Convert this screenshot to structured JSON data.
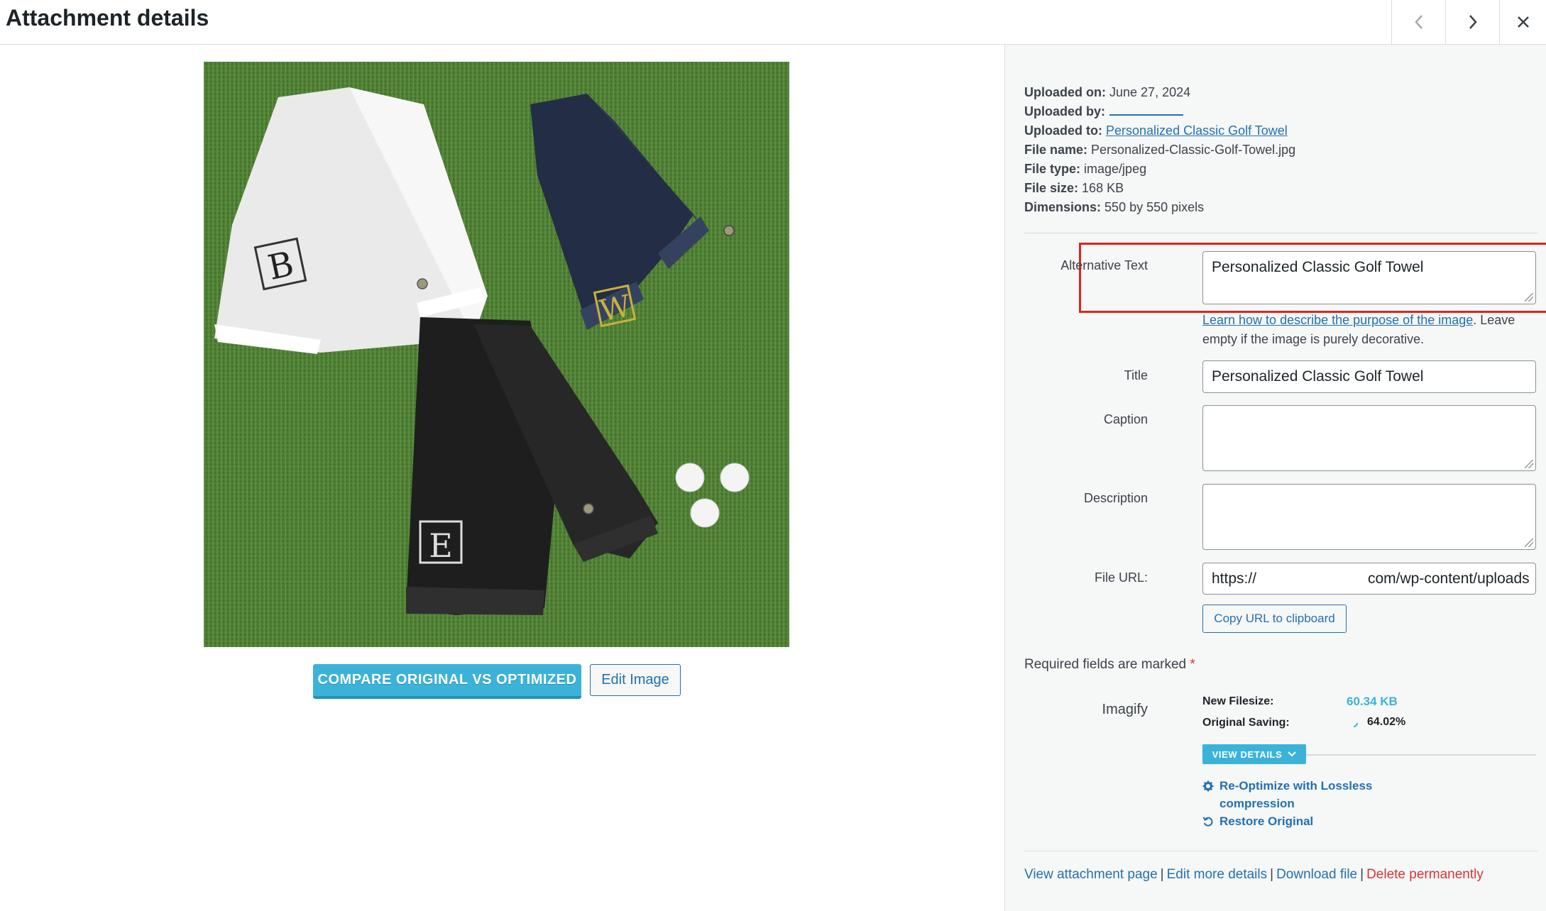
{
  "header": {
    "title": "Attachment details",
    "prev_icon": "chevron-left-icon",
    "next_icon": "chevron-right-icon",
    "close_icon": "close-icon"
  },
  "image": {
    "monograms": [
      "B",
      "W",
      "E"
    ]
  },
  "buttons": {
    "compare": "COMPARE ORIGINAL VS OPTIMIZED",
    "edit_image": "Edit Image"
  },
  "meta": {
    "uploaded_on_label": "Uploaded on:",
    "uploaded_on": "June 27, 2024",
    "uploaded_by_label": "Uploaded by:",
    "uploaded_to_label": "Uploaded to:",
    "uploaded_to": "Personalized Classic Golf Towel",
    "file_name_label": "File name:",
    "file_name": "Personalized-Classic-Golf-Towel.jpg",
    "file_type_label": "File type:",
    "file_type": "image/jpeg",
    "file_size_label": "File size:",
    "file_size": "168 KB",
    "dimensions_label": "Dimensions:",
    "dimensions": "550 by 550 pixels"
  },
  "fields": {
    "alt_label": "Alternative Text",
    "alt_value": "Personalized Classic Golf Towel",
    "alt_help_link": "Learn how to describe the purpose of the image",
    "alt_help_text": ". Leave empty if the image is purely decorative.",
    "title_label": "Title",
    "title_value": "Personalized Classic Golf Towel",
    "caption_label": "Caption",
    "caption_value": "",
    "description_label": "Description",
    "description_value": "",
    "file_url_label": "File URL:",
    "file_url_start": "https://",
    "file_url_end": "com/wp-content/uploads",
    "copy_url": "Copy URL to clipboard"
  },
  "required": {
    "text": "Required fields are marked",
    "star": "*"
  },
  "imagify": {
    "label": "Imagify",
    "new_filesize_label": "New Filesize:",
    "new_filesize": "60.34 KB",
    "original_saving_label": "Original Saving:",
    "original_saving": "64.02%",
    "view_details": "VIEW DETAILS",
    "reoptimize_line1": "Re-Optimize with Lossless",
    "reoptimize_line2": "compression",
    "restore": "Restore Original",
    "accent_color": "#3bb3d9"
  },
  "footer_links": {
    "view_attachment": "View attachment page",
    "edit_more": "Edit more details",
    "download": "Download file",
    "delete": "Delete permanently",
    "separator": "|"
  }
}
